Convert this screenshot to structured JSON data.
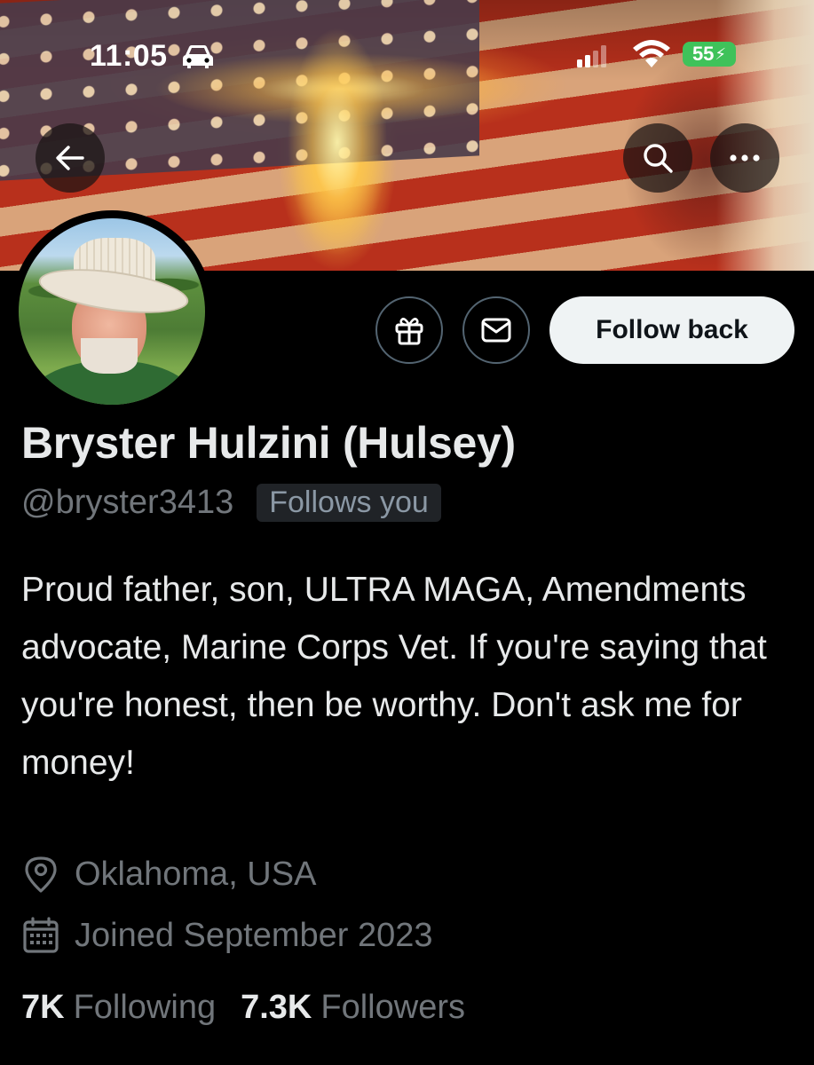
{
  "status_bar": {
    "time": "11:05",
    "battery": "55",
    "icons": [
      "car-icon",
      "cellular-signal-icon",
      "wifi-icon",
      "battery-charging-icon"
    ]
  },
  "header": {
    "back_icon": "arrow-left-icon",
    "search_icon": "search-icon",
    "more_icon": "more-horizontal-icon"
  },
  "profile": {
    "display_name": "Bryster Hulzini (Hulsey)",
    "handle": "@bryster3413",
    "follows_you": "Follows you",
    "bio": "Proud father, son, ULTRA MAGA, Amendments advocate, Marine Corps Vet. If you're saying that you're honest, then be worthy. Don't ask me for money!",
    "location": "Oklahoma, USA",
    "joined": "Joined September 2023",
    "following_count": "7K",
    "following_label": "Following",
    "followers_count": "7.3K",
    "followers_label": "Followers"
  },
  "actions": {
    "gift_icon": "gift-icon",
    "message_icon": "mail-icon",
    "follow_label": "Follow back"
  },
  "colors": {
    "background": "#000000",
    "primary_text": "#e7e9ea",
    "secondary_text": "#71767b",
    "follow_button_bg": "#eff3f4",
    "battery_green": "#3fc25a"
  }
}
